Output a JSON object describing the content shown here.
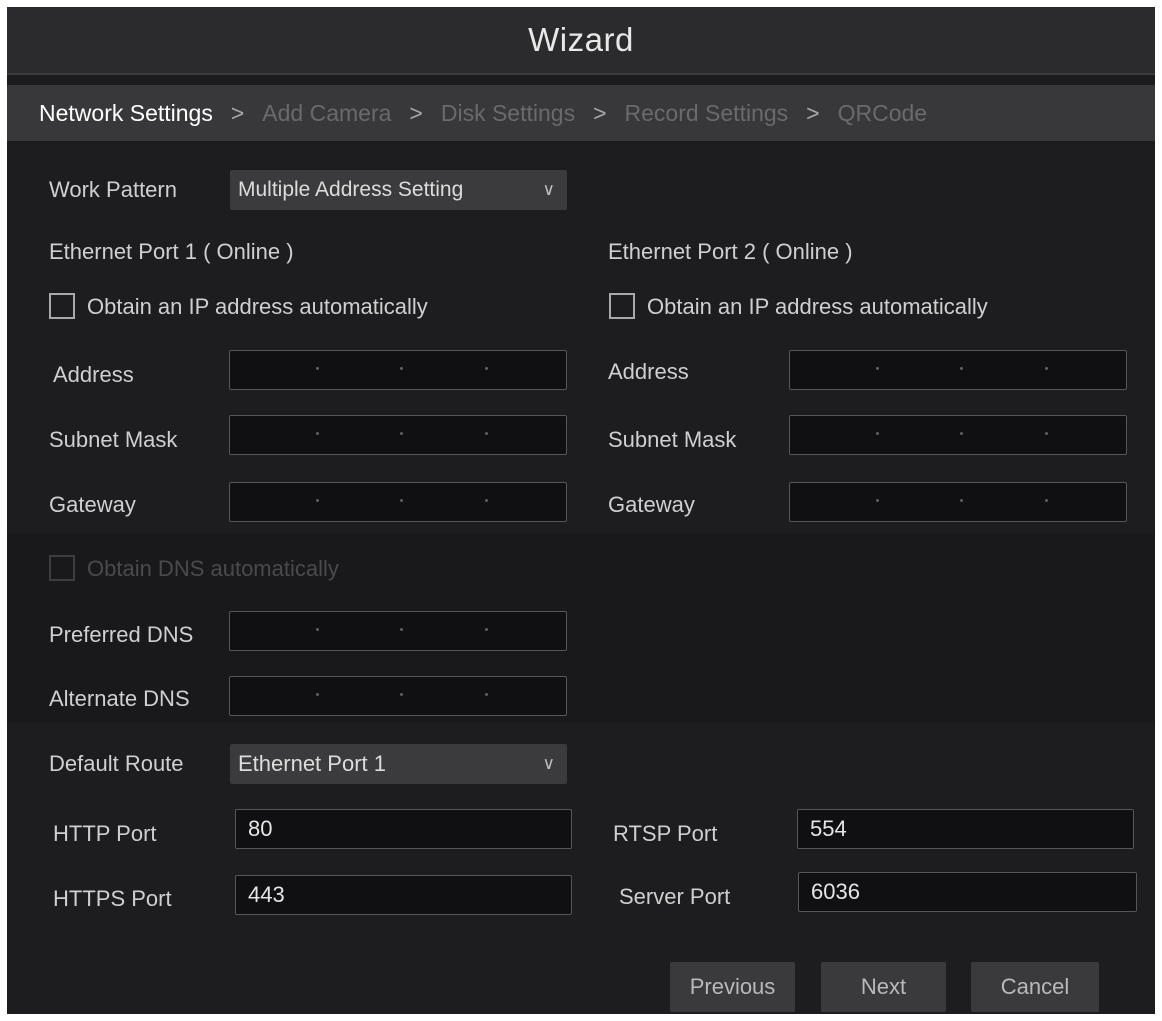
{
  "window": {
    "title": "Wizard"
  },
  "steps": [
    {
      "label": "Network Settings",
      "active": true
    },
    {
      "label": "Add Camera",
      "active": false
    },
    {
      "label": "Disk Settings",
      "active": false
    },
    {
      "label": "Record Settings",
      "active": false
    },
    {
      "label": "QRCode",
      "active": false
    }
  ],
  "step_separator": ">",
  "work_pattern": {
    "label": "Work Pattern",
    "value": "Multiple Address Setting"
  },
  "port1": {
    "heading": "Ethernet Port 1 ( Online )",
    "auto_ip_label": "Obtain an IP address automatically",
    "auto_ip_checked": false,
    "address_label": "Address",
    "subnet_label": "Subnet Mask",
    "gateway_label": "Gateway"
  },
  "port2": {
    "heading": "Ethernet Port 2 ( Online )",
    "auto_ip_label": "Obtain an IP address automatically",
    "auto_ip_checked": false,
    "address_label": "Address",
    "subnet_label": "Subnet Mask",
    "gateway_label": "Gateway"
  },
  "dns": {
    "auto_label": "Obtain DNS automatically",
    "auto_disabled": true,
    "preferred_label": "Preferred DNS",
    "alternate_label": "Alternate DNS"
  },
  "default_route": {
    "label": "Default Route",
    "value": "Ethernet Port 1"
  },
  "ports": {
    "http_label": "HTTP Port",
    "http_value": "80",
    "https_label": "HTTPS Port",
    "https_value": "443",
    "rtsp_label": "RTSP Port",
    "rtsp_value": "554",
    "server_label": "Server Port",
    "server_value": "6036"
  },
  "buttons": {
    "previous": "Previous",
    "next": "Next",
    "cancel": "Cancel"
  },
  "icons": {
    "dropdown": "chevron-down-icon",
    "checkbox": "checkbox-icon"
  },
  "colors": {
    "background": "#1d1d1f",
    "titlebar": "#2b2b2d",
    "active_step": "#ffffff",
    "inactive_step": "#6a6a6d"
  }
}
